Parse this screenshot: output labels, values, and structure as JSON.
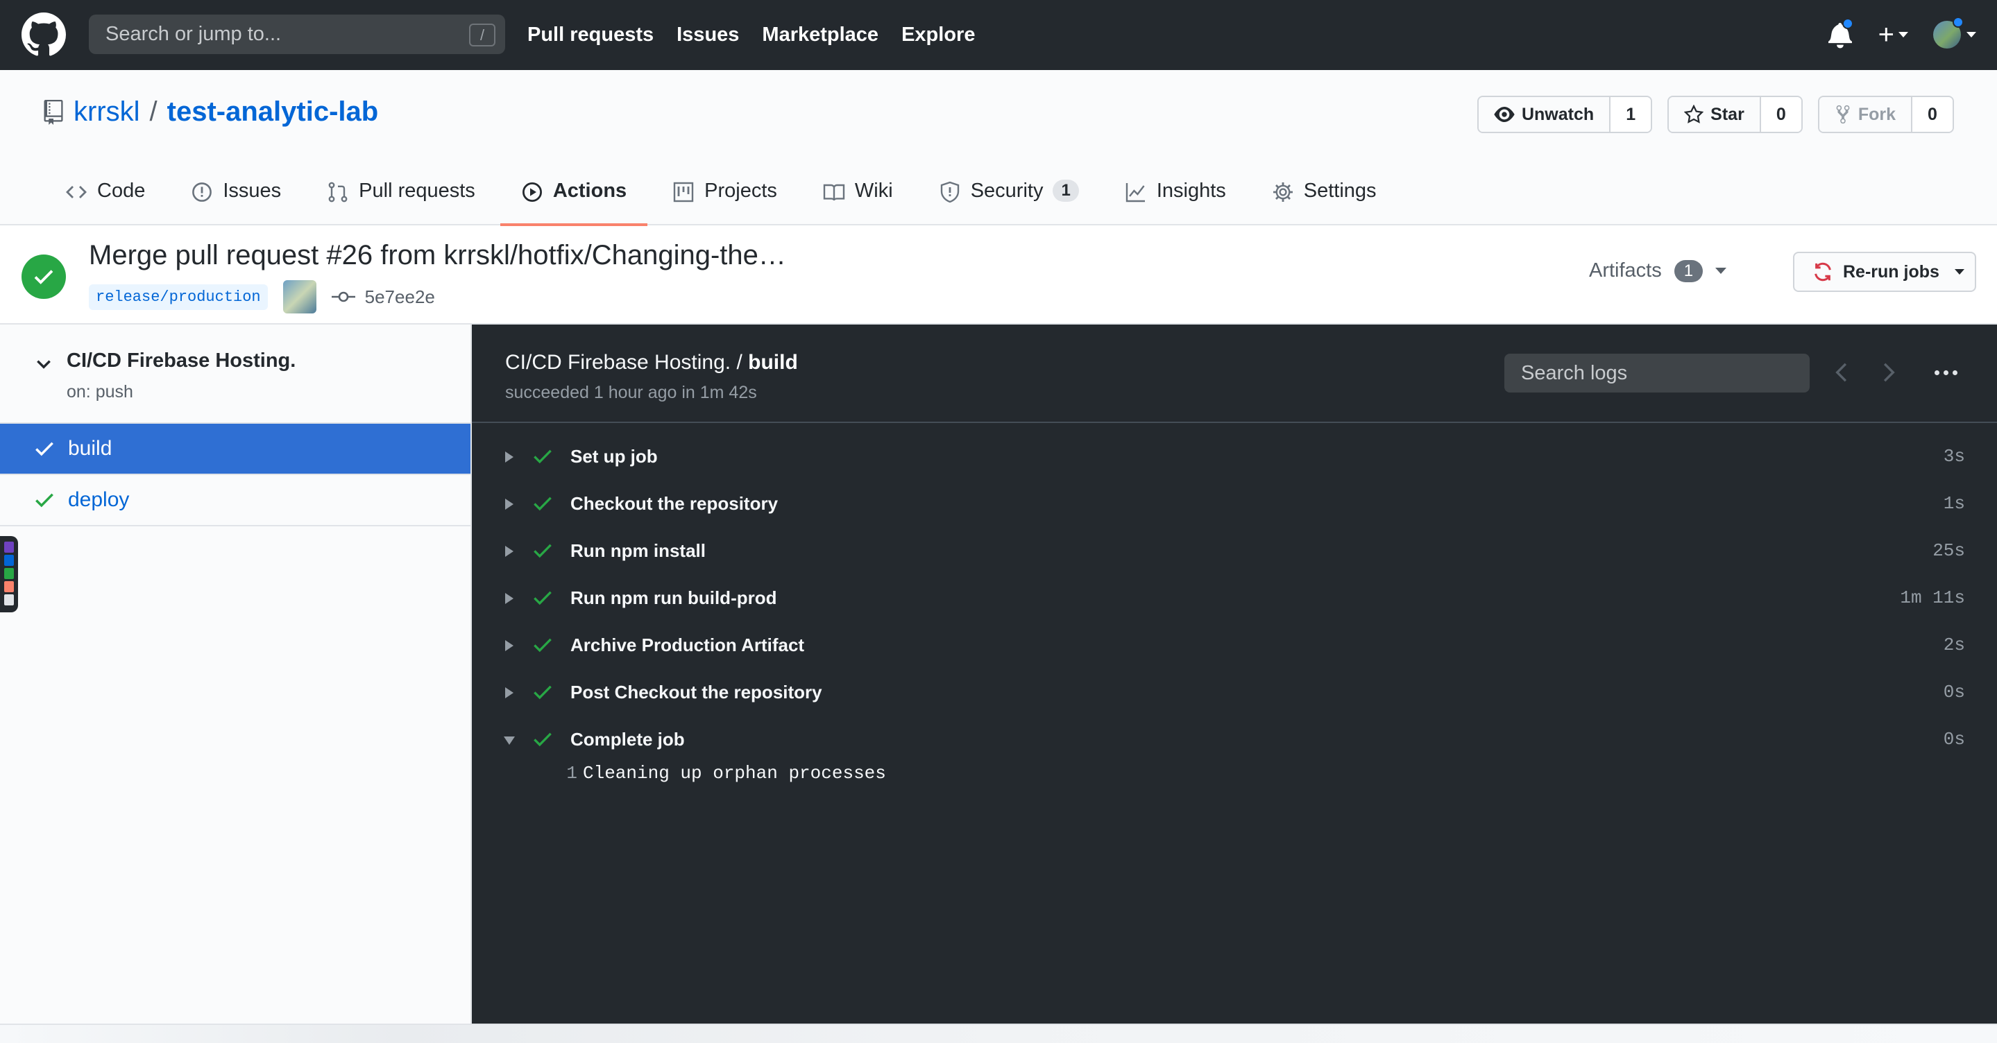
{
  "topbar": {
    "search_placeholder": "Search or jump to...",
    "search_shortcut": "/",
    "nav": [
      "Pull requests",
      "Issues",
      "Marketplace",
      "Explore"
    ],
    "plus_label": "+"
  },
  "repo": {
    "owner": "krrskl",
    "separator": "/",
    "name": "test-analytic-lab",
    "watch": {
      "label": "Unwatch",
      "count": "1"
    },
    "star": {
      "label": "Star",
      "count": "0"
    },
    "fork": {
      "label": "Fork",
      "count": "0"
    }
  },
  "tabs": [
    {
      "label": "Code",
      "icon": "code-icon"
    },
    {
      "label": "Issues",
      "icon": "issue-icon"
    },
    {
      "label": "Pull requests",
      "icon": "pull-request-icon"
    },
    {
      "label": "Actions",
      "icon": "play-icon",
      "active": true
    },
    {
      "label": "Projects",
      "icon": "project-icon"
    },
    {
      "label": "Wiki",
      "icon": "book-icon"
    },
    {
      "label": "Security",
      "icon": "shield-icon",
      "badge": "1"
    },
    {
      "label": "Insights",
      "icon": "graph-icon"
    },
    {
      "label": "Settings",
      "icon": "gear-icon"
    }
  ],
  "run": {
    "title": "Merge pull request #26 from krrskl/hotfix/Changing-the…",
    "branch": "release/production",
    "commit": "5e7ee2e",
    "artifacts_label": "Artifacts",
    "artifacts_count": "1",
    "rerun_label": "Re-run jobs"
  },
  "sidebar": {
    "workflow_name": "CI/CD Firebase Hosting.",
    "trigger": "on: push",
    "jobs": [
      {
        "label": "build",
        "active": true
      },
      {
        "label": "deploy",
        "active": false
      }
    ]
  },
  "logs": {
    "workflow": "CI/CD Firebase Hosting. /",
    "job": "build",
    "status": "succeeded 1 hour ago in 1m 42s",
    "search_placeholder": "Search logs",
    "steps": [
      {
        "label": "Set up job",
        "duration": "3s"
      },
      {
        "label": "Checkout the repository",
        "duration": "1s"
      },
      {
        "label": "Run npm install",
        "duration": "25s"
      },
      {
        "label": "Run npm run build-prod",
        "duration": "1m 11s"
      },
      {
        "label": "Archive Production Artifact",
        "duration": "2s"
      },
      {
        "label": "Post Checkout the repository",
        "duration": "0s"
      },
      {
        "label": "Complete job",
        "duration": "0s",
        "expanded": true
      }
    ],
    "lines": [
      {
        "num": "1",
        "text": "Cleaning up orphan processes"
      }
    ]
  },
  "colors": {
    "header_bg": "#24292e",
    "link": "#0366d6",
    "success": "#28a745",
    "active_tab_underline": "#f9826c",
    "active_job_bg": "#2f6fd3",
    "log_bg": "#24292e"
  }
}
